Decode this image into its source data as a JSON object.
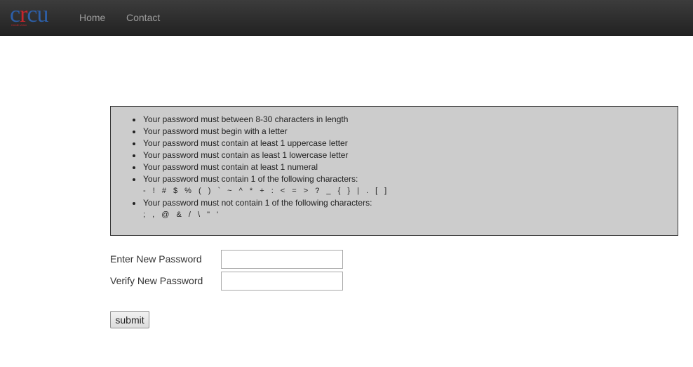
{
  "navbar": {
    "brand": {
      "letters": [
        "c",
        "r",
        "cu"
      ],
      "tagline": "Credit Union",
      "colors": {
        "blue": "#2d5fa8",
        "red": "#c8252c"
      }
    },
    "links": [
      {
        "label": "Home"
      },
      {
        "label": "Contact"
      }
    ]
  },
  "rules": {
    "items": [
      {
        "text": "Your password must between 8-30 characters in length"
      },
      {
        "text": "Your password must begin with a letter"
      },
      {
        "text": "Your password must contain at least 1 uppercase letter"
      },
      {
        "text": "Your password must contain as least 1 lowercase letter"
      },
      {
        "text": "Your password must contain at least 1 numeral"
      },
      {
        "text": "Your password must contain 1 of the following characters:",
        "chars": "- ! # $ % ( ) ` ~ ^ * + : < = > ? _ { } | . [ ]"
      },
      {
        "text": "Your password must not contain 1 of the following characters:",
        "chars": "; , @ & / \\ \" '"
      }
    ]
  },
  "form": {
    "new_password": {
      "label": "Enter New Password",
      "value": ""
    },
    "verify_password": {
      "label": "Verify New Password",
      "value": ""
    },
    "submit_label": "submit"
  }
}
